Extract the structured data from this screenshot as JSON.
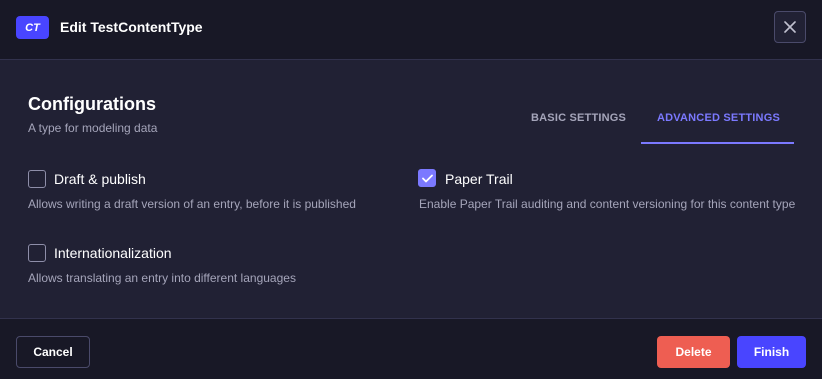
{
  "header": {
    "badge": "CT",
    "title": "Edit TestContentType",
    "close_icon": "close-icon"
  },
  "configurations": {
    "title": "Configurations",
    "subtitle": "A type for modeling data"
  },
  "tabs": [
    {
      "label": "BASIC SETTINGS",
      "active": false
    },
    {
      "label": "ADVANCED SETTINGS",
      "active": true
    }
  ],
  "options": {
    "draft_publish": {
      "label": "Draft & publish",
      "description": "Allows writing a draft version of an entry, before it is published",
      "checked": false
    },
    "internationalization": {
      "label": "Internationalization",
      "description": "Allows translating an entry into different languages",
      "checked": false
    },
    "paper_trail": {
      "label": "Paper Trail",
      "description": "Enable Paper Trail auditing and content versioning for this content type",
      "checked": true
    }
  },
  "footer": {
    "cancel_label": "Cancel",
    "delete_label": "Delete",
    "finish_label": "Finish"
  },
  "colors": {
    "primary": "#4945ff",
    "accent": "#7b79ff",
    "danger": "#ee5e52",
    "background": "#212134",
    "header_background": "#181826"
  }
}
